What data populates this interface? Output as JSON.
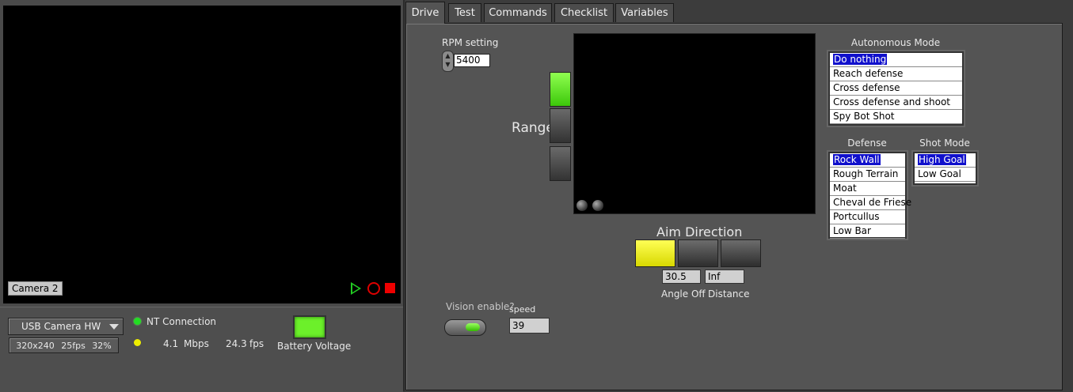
{
  "camera": {
    "label": "Camera 2",
    "source": "USB Camera HW",
    "resolution": "320x240",
    "fps_setting": "25fps",
    "quality": "32%"
  },
  "status": {
    "nt_connection_label": "NT Connection",
    "nt_connected": true,
    "bandwidth_value": "4.1",
    "bandwidth_unit": "Mbps",
    "fps_value": "24.3",
    "fps_unit": "fps",
    "battery_label": "Battery Voltage",
    "battery_color": "#6cf02a"
  },
  "tabs": [
    {
      "label": "Drive",
      "active": true
    },
    {
      "label": "Test",
      "active": false
    },
    {
      "label": "Commands",
      "active": false
    },
    {
      "label": "Checklist",
      "active": false
    },
    {
      "label": "Variables",
      "active": false
    }
  ],
  "drive": {
    "rpm_label": "RPM setting",
    "rpm_value": "5400",
    "range_label": "Range",
    "range_selected_index": 0,
    "aim_label": "Aim Direction",
    "aim_selected_index": 0,
    "angle_off_value": "30.5",
    "distance_value": "Inf",
    "angle_off_label": "Angle Off",
    "distance_label": "Distance",
    "vision_enable_label": "Vision enable?",
    "vision_enabled": true,
    "speed_label": "speed",
    "speed_value": "39",
    "autonomous": {
      "title": "Autonomous Mode",
      "items": [
        "Do nothing",
        "Reach defense",
        "Cross defense",
        "Cross defense and shoot",
        "Spy Bot Shot"
      ],
      "selected": "Do nothing"
    },
    "defense": {
      "title": "Defense",
      "items": [
        "Rock Wall",
        "Rough Terrain",
        "Moat",
        "Cheval de Friese",
        "Portcullus",
        "Low Bar"
      ],
      "selected": "Rock Wall"
    },
    "shot_mode": {
      "title": "Shot Mode",
      "items": [
        "High Goal",
        "Low Goal"
      ],
      "selected": "High Goal"
    }
  },
  "colors": {
    "active_green": "#6cf02a",
    "active_yellow": "#eeee00",
    "selection_blue": "#1010cc"
  }
}
